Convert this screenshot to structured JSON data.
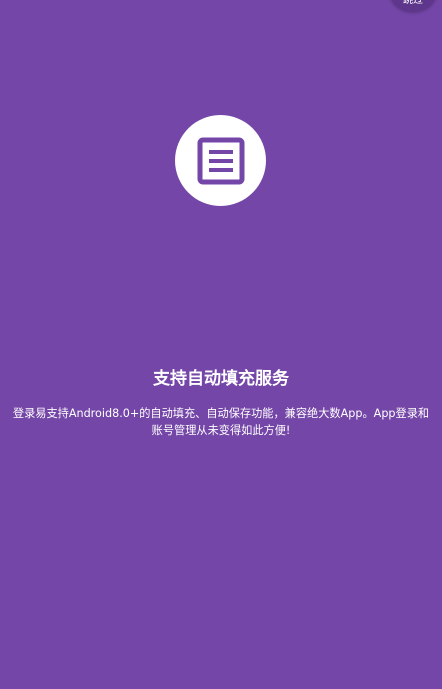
{
  "skip": {
    "label": "跳过"
  },
  "feature": {
    "icon": "document-list-icon",
    "title": "支持自动填充服务",
    "description": "登录易支持Android8.0+的自动填充、自动保存功能，兼容绝大数App。App登录和账号管理从未变得如此方便!"
  },
  "colors": {
    "background": "#7446a8",
    "icon_circle": "#ffffff",
    "icon": "#7446a8",
    "text": "#ffffff"
  }
}
